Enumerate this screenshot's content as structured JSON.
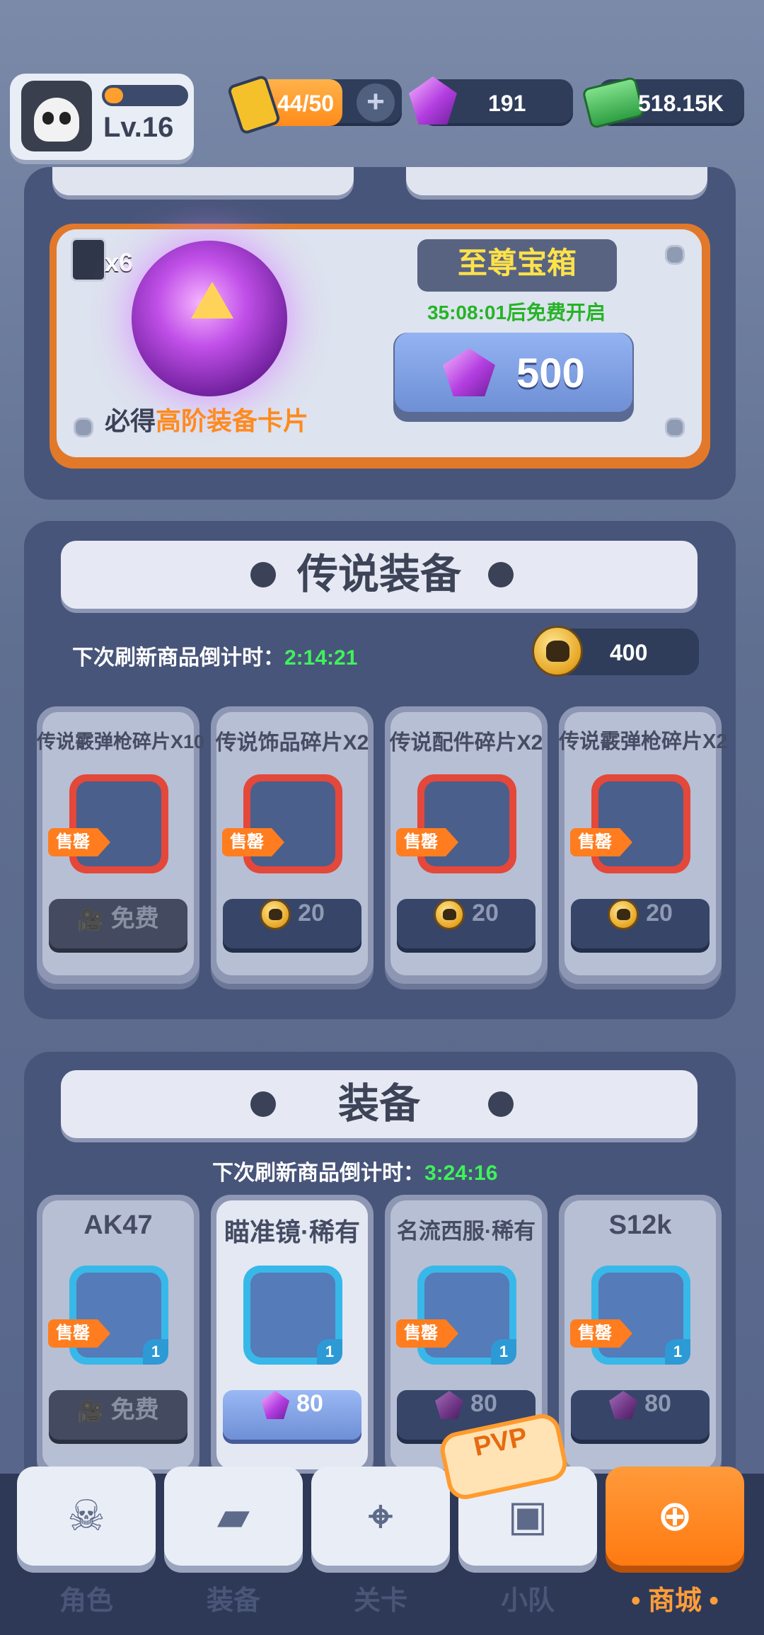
{
  "player": {
    "level": "Lv.16"
  },
  "resources": {
    "energy": "44/50",
    "gems": "191",
    "cash": "518.15K"
  },
  "chest": {
    "card_count": "x6",
    "title": "至尊宝箱",
    "timer": "35:08:01后免费开启",
    "price": "500",
    "subtitle_prefix": "必得",
    "subtitle_highlight": "高阶装备卡片"
  },
  "legendary": {
    "title": "传说装备",
    "refresh_label": "下次刷新商品倒计时：",
    "refresh_time": "2:14:21",
    "coin_balance": "400",
    "items": [
      {
        "name": "传说霰弹枪碎片X10",
        "tag": "售罄",
        "button": "免费"
      },
      {
        "name": "传说饰品碎片X2",
        "tag": "售罄",
        "price": "20"
      },
      {
        "name": "传说配件碎片X2",
        "tag": "售罄",
        "price": "20"
      },
      {
        "name": "传说霰弹枪碎片X2",
        "tag": "售罄",
        "price": "20"
      }
    ]
  },
  "equipment": {
    "title": "装备",
    "refresh_label": "下次刷新商品倒计时：",
    "refresh_time": "3:24:16",
    "items": [
      {
        "name": "AK47",
        "tag": "售罄",
        "qty": "1",
        "button": "免费"
      },
      {
        "name": "瞄准镜·稀有",
        "qty": "1",
        "price": "80"
      },
      {
        "name": "名流西服·稀有",
        "tag": "售罄",
        "qty": "1",
        "price": "80"
      },
      {
        "name": "S12k",
        "tag": "售罄",
        "qty": "1",
        "price": "80"
      }
    ]
  },
  "nav": {
    "badge": "PVP",
    "tabs": [
      "角色",
      "装备",
      "关卡",
      "小队",
      "• 商城 •"
    ]
  },
  "colors": {
    "accent": "#ff7a12",
    "timer_green": "#3ff25a",
    "chest_green": "#27b327",
    "title_yellow": "#ffe24a"
  },
  "icons": [
    "skull-avatar",
    "battery-icon",
    "gem-icon",
    "cash-icon",
    "coin-icon",
    "video-icon",
    "orb-chest"
  ]
}
